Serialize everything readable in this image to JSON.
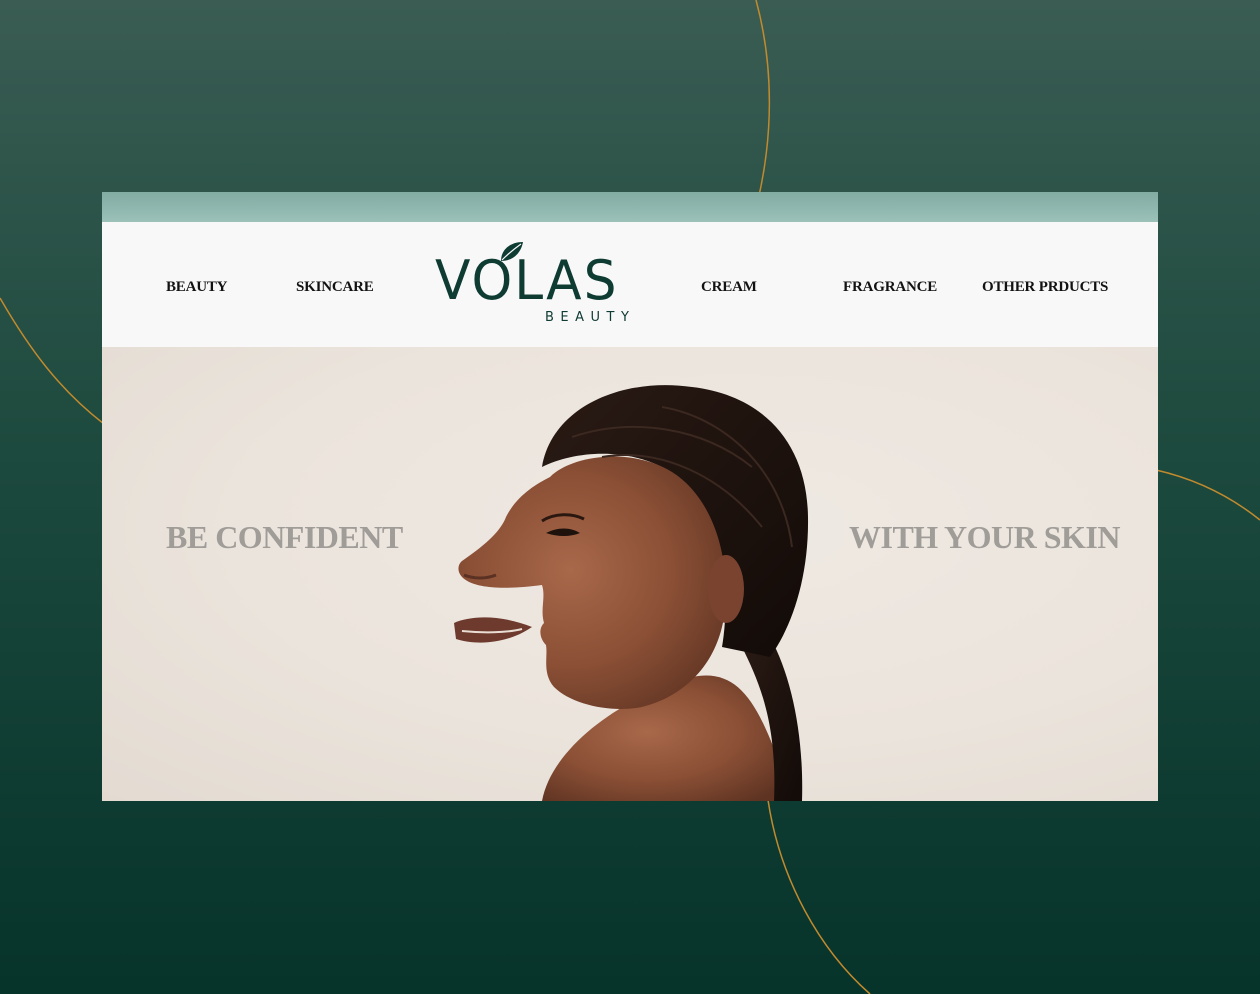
{
  "colors": {
    "background_dark": "#06332a",
    "background_light": "#3a5c53",
    "accent_line": "#c08a2e",
    "brand": "#0e3b32",
    "hero_text": "#a09c98"
  },
  "nav": {
    "items": [
      {
        "label": "BEAUTY"
      },
      {
        "label": "SKINCARE"
      },
      {
        "label": "CREAM"
      },
      {
        "label": "FRAGRANCE"
      },
      {
        "label": "OTHER PRDUCTS"
      }
    ]
  },
  "logo": {
    "brand": "VOLAS",
    "sub": "BEAUTY",
    "icon": "leaf-icon"
  },
  "hero": {
    "left_text": "BE CONFIDENT",
    "right_text": "WITH YOUR SKIN",
    "image": "woman-portrait"
  }
}
